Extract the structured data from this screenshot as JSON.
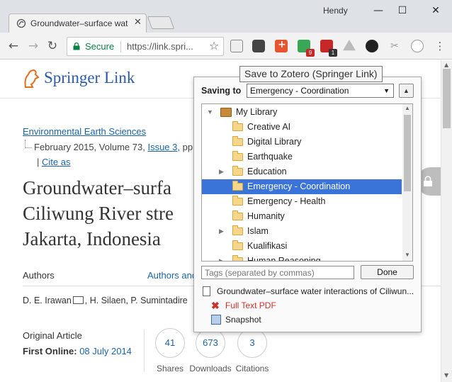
{
  "browser": {
    "tab_title": "Groundwater–surface wat",
    "profile_name": "Hendy",
    "secure_label": "Secure",
    "url": "https://link.spri...",
    "extension_badges": {
      "green": "9",
      "red": "1"
    }
  },
  "tooltip": "Save to Zotero (Springer Link)",
  "zotero": {
    "saving_to_label": "Saving to",
    "selected_collection": "Emergency - Coordination",
    "tree": [
      {
        "label": "My Library",
        "type": "library",
        "expanded": true
      },
      {
        "label": "Creative AI",
        "type": "folder"
      },
      {
        "label": "Digital Library",
        "type": "folder"
      },
      {
        "label": "Earthquake",
        "type": "folder"
      },
      {
        "label": "Education",
        "type": "folder",
        "collapsed": true
      },
      {
        "label": "Emergency - Coordination",
        "type": "folder",
        "selected": true
      },
      {
        "label": "Emergency - Health",
        "type": "folder"
      },
      {
        "label": "Humanity",
        "type": "folder"
      },
      {
        "label": "Islam",
        "type": "folder",
        "collapsed": true
      },
      {
        "label": "Kualifikasi",
        "type": "folder"
      },
      {
        "label": "Human Reasoning",
        "type": "folder",
        "collapsed": true
      }
    ],
    "tags_placeholder": "Tags (separated by commas)",
    "done_label": "Done",
    "item_title": "Groundwater–surface water interactions of Ciliwun...",
    "attachments": [
      {
        "label": "Full Text PDF",
        "status": "failed",
        "color": "#d0302a"
      },
      {
        "label": "Snapshot",
        "status": "ok",
        "color": "#222222"
      }
    ]
  },
  "page": {
    "brand_name": "Springer",
    "brand_suffix": "Link",
    "journal": "Environmental Earth Sciences",
    "issue_prefix": "February 2015, Volume 73,",
    "issue_link": "Issue 3",
    "issue_suffix": ", pp",
    "cite_as": "Cite as",
    "title": "Groundwater–surface water interactions of Ciliwung River streams, segment Bogor–Jakarta, Indonesia",
    "title_lines": [
      "Groundwater–surfa",
      "Ciliwung River stre",
      "Jakarta, Indonesia"
    ],
    "tab_authors": "Authors",
    "tab_affiliations": "Authors and affiliations",
    "authors_first": "D. E. Irawan",
    "authors_rest": ", H. Silaen, P. Sumintadire",
    "article_type": "Original Article",
    "first_online_label": "First Online:",
    "first_online_date": "08 July 2014",
    "metrics": [
      {
        "value": "41",
        "label": "Shares"
      },
      {
        "value": "673",
        "label": "Downloads"
      },
      {
        "value": "3",
        "label": "Citations"
      }
    ]
  },
  "colors": {
    "link": "#1a63a8",
    "selection": "#3a74d9",
    "secure": "#0b8043"
  }
}
